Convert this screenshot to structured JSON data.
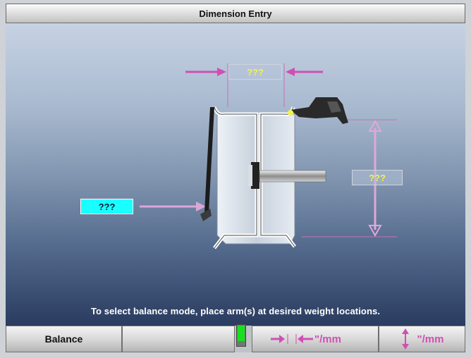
{
  "window": {
    "title": "Dimension Entry"
  },
  "dimensions": {
    "width": "???",
    "diameter": "???",
    "offset": "???"
  },
  "instruction": "To select balance mode, place arm(s) at desired weight locations.",
  "bottom_bar": {
    "balance_label": "Balance",
    "width_unit_label": "\"/mm",
    "diameter_unit_label": "\"/mm"
  },
  "colors": {
    "accent_cyan": "#19ffff",
    "value_yellow": "#f2f24a",
    "arrow_pink": "#d14fb4",
    "indicator_green": "#18e020"
  },
  "icons": [
    "width-arrows-icon",
    "diameter-arrows-icon",
    "wheel-rim-icon",
    "sensor-arm-icon"
  ]
}
